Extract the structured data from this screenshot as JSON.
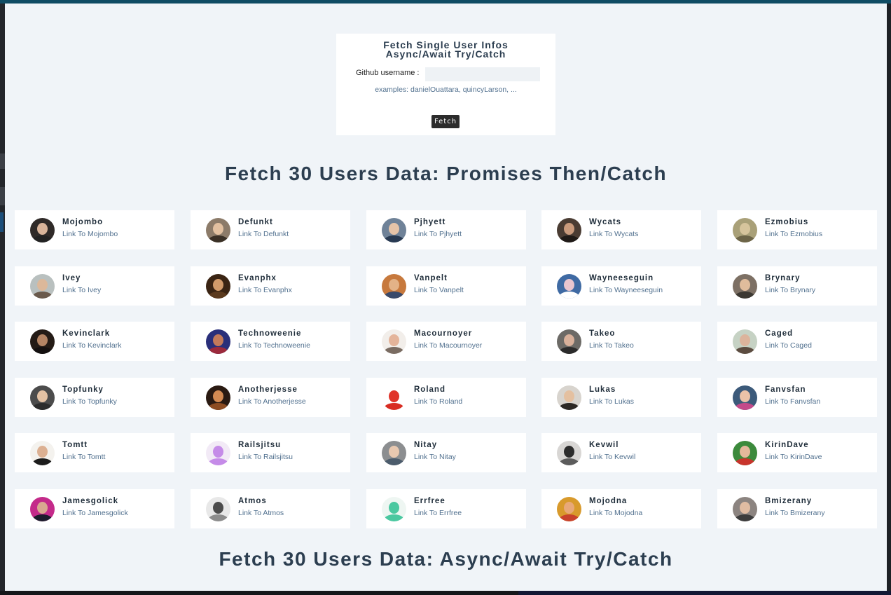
{
  "single_user": {
    "title_line1": "Fetch Single User Infos",
    "title_line2": "Async/Await Try/Catch",
    "username_label": "Github username :",
    "username_value": "",
    "examples": "examples: danielOuattara, quincyLarson, ...",
    "fetch_button": "Fetch"
  },
  "section1_title": "Fetch 30 Users Data: Promises Then/Catch",
  "section2_title": "Fetch 30 Users Data: Async/Await Try/Catch",
  "users": [
    {
      "name": "Mojombo",
      "link": "Link To Mojombo",
      "bg": "#2f2a28",
      "face": "#d9b49a",
      "body": "#222222"
    },
    {
      "name": "Defunkt",
      "link": "Link To Defunkt",
      "bg": "#8c7b69",
      "face": "#e2c0a0",
      "body": "#3a3026"
    },
    {
      "name": "Pjhyett",
      "link": "Link To Pjhyett",
      "bg": "#6f8298",
      "face": "#e6c4a8",
      "body": "#283a52"
    },
    {
      "name": "Wycats",
      "link": "Link To Wycats",
      "bg": "#4a3c33",
      "face": "#c99a7c",
      "body": "#1f1a17"
    },
    {
      "name": "Ezmobius",
      "link": "Link To Ezmobius",
      "bg": "#a9a078",
      "face": "#d6c49c",
      "body": "#6d6548"
    },
    {
      "name": "Ivey",
      "link": "Link To Ivey",
      "bg": "#b9c0bf",
      "face": "#dcb89a",
      "body": "#6a5a4c"
    },
    {
      "name": "Evanphx",
      "link": "Link To Evanphx",
      "bg": "#3a2413",
      "face": "#d19a6a",
      "body": "#5b3a1e"
    },
    {
      "name": "Vanpelt",
      "link": "Link To Vanpelt",
      "bg": "#c7793d",
      "face": "#e3b287",
      "body": "#3a4a6a"
    },
    {
      "name": "Wayneeseguin",
      "link": "Link To Wayneeseguin",
      "bg": "#3f6aa3",
      "face": "#e9c5cf",
      "body": "#ffffff"
    },
    {
      "name": "Brynary",
      "link": "Link To Brynary",
      "bg": "#7d7064",
      "face": "#e0bc9c",
      "body": "#3c3832"
    },
    {
      "name": "Kevinclark",
      "link": "Link To Kevinclark",
      "bg": "#241b16",
      "face": "#b48464",
      "body": "#141010"
    },
    {
      "name": "Technoweenie",
      "link": "Link To Technoweenie",
      "bg": "#2a2f7a",
      "face": "#c47a5a",
      "body": "#9c2a3c"
    },
    {
      "name": "Macournoyer",
      "link": "Link To Macournoyer",
      "bg": "#f2eeea",
      "face": "#e4b49a",
      "body": "#7a6c62"
    },
    {
      "name": "Takeo",
      "link": "Link To Takeo",
      "bg": "#6c6a66",
      "face": "#d8b09a",
      "body": "#2b2b2b"
    },
    {
      "name": "Caged",
      "link": "Link To Caged",
      "bg": "#c6d2c4",
      "face": "#dcb49c",
      "body": "#5c4c40"
    },
    {
      "name": "Topfunky",
      "link": "Link To Topfunky",
      "bg": "#4c4c4c",
      "face": "#e4c2a4",
      "body": "#2c2c2c"
    },
    {
      "name": "Anotherjesse",
      "link": "Link To Anotherjesse",
      "bg": "#2a1a12",
      "face": "#d48a52",
      "body": "#8c4c22"
    },
    {
      "name": "Roland",
      "link": "Link To Roland",
      "bg": "#ffffff",
      "face": "#e0342a",
      "body": "#d82c22"
    },
    {
      "name": "Lukas",
      "link": "Link To Lukas",
      "bg": "#d8d4ce",
      "face": "#e4c0a0",
      "body": "#2c2824"
    },
    {
      "name": "Fanvsfan",
      "link": "Link To Fanvsfan",
      "bg": "#3c5a7a",
      "face": "#eac2a8",
      "body": "#c44a8a"
    },
    {
      "name": "Tomtt",
      "link": "Link To Tomtt",
      "bg": "#f4f2ee",
      "face": "#dcb092",
      "body": "#1c1c1c"
    },
    {
      "name": "Railsjitsu",
      "link": "Link To Railsjitsu",
      "bg": "#f2eaf6",
      "face": "#c58be8",
      "body": "#c58be8"
    },
    {
      "name": "Nitay",
      "link": "Link To Nitay",
      "bg": "#8c8e90",
      "face": "#e8c8b0",
      "body": "#4c5c6c"
    },
    {
      "name": "Kevwil",
      "link": "Link To Kevwil",
      "bg": "#d8d6d4",
      "face": "#2c2c2c",
      "body": "#5c5c5c"
    },
    {
      "name": "KirinDave",
      "link": "Link To KirinDave",
      "bg": "#3c8a3c",
      "face": "#e4b89c",
      "body": "#c8342c"
    },
    {
      "name": "Jamesgolick",
      "link": "Link To Jamesgolick",
      "bg": "#c42a8a",
      "face": "#d8a890",
      "body": "#1c1c2c"
    },
    {
      "name": "Atmos",
      "link": "Link To Atmos",
      "bg": "#e8e8e8",
      "face": "#4c4c4c",
      "body": "#8c8c8c"
    },
    {
      "name": "Errfree",
      "link": "Link To Errfree",
      "bg": "#eef6f2",
      "face": "#4ac8a0",
      "body": "#4ac8a0"
    },
    {
      "name": "Mojodna",
      "link": "Link To Mojodna",
      "bg": "#d89a2c",
      "face": "#e8a878",
      "body": "#c8422c"
    },
    {
      "name": "Bmizerany",
      "link": "Link To Bmizerany",
      "bg": "#8c8480",
      "face": "#e0bca2",
      "body": "#3c3c3c"
    }
  ]
}
